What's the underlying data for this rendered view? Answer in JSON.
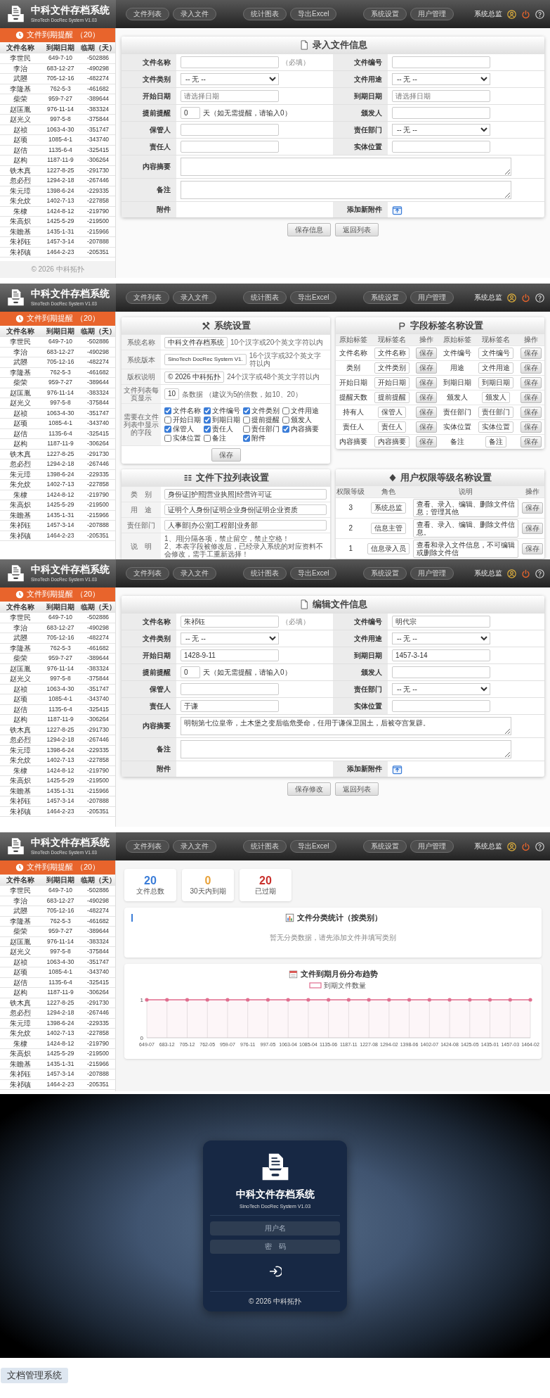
{
  "screens": [
    {
      "kind": "form",
      "header": {
        "title": "中科文件存档系统",
        "subtitle": "SinoTech DocRec System V1.03",
        "nav_groups": [
          [
            "文件列表",
            "录入文件"
          ],
          [
            "统计图表",
            "导出Excel"
          ],
          [
            "系统设置",
            "用户管理"
          ]
        ],
        "user": "系统总监"
      },
      "sidebar": {
        "title": "文件到期提醒",
        "count": "（20）",
        "columns": [
          "文件名称",
          "到期日期",
          "临期（天）"
        ],
        "footer": "© 2026 中科拓扑",
        "rows": [
          [
            "李世民",
            "649-7-10",
            "-502886"
          ],
          [
            "李治",
            "683-12-27",
            "-490298"
          ],
          [
            "武曌",
            "705-12-16",
            "-482274"
          ],
          [
            "李隆基",
            "762-5-3",
            "-461682"
          ],
          [
            "柴荣",
            "959-7-27",
            "-389644"
          ],
          [
            "赵匡胤",
            "976-11-14",
            "-383324"
          ],
          [
            "赵光义",
            "997-5-8",
            "-375844"
          ],
          [
            "赵祯",
            "1063-4-30",
            "-351747"
          ],
          [
            "赵顼",
            "1085-4-1",
            "-343740"
          ],
          [
            "赵佶",
            "1135-6-4",
            "-325415"
          ],
          [
            "赵构",
            "1187-11-9",
            "-306264"
          ],
          [
            "铁木真",
            "1227-8-25",
            "-291730"
          ],
          [
            "忽必烈",
            "1294-2-18",
            "-267446"
          ],
          [
            "朱元璋",
            "1398-6-24",
            "-229335"
          ],
          [
            "朱允炆",
            "1402-7-13",
            "-227858"
          ],
          [
            "朱棣",
            "1424-8-12",
            "-219790"
          ],
          [
            "朱高炽",
            "1425-5-29",
            "-219500"
          ],
          [
            "朱瞻基",
            "1435-1-31",
            "-215966"
          ],
          [
            "朱祁钰",
            "1457-3-14",
            "-207888"
          ],
          [
            "朱祁镇",
            "1464-2-23",
            "-205351"
          ]
        ]
      },
      "content": {
        "title": "录入文件信息",
        "rows": [
          {
            "kind": "pair",
            "cells": [
              {
                "label": "文件名称",
                "kind": "text",
                "hint": "（必填）"
              },
              {
                "label": "文件编号",
                "kind": "text"
              }
            ]
          },
          {
            "kind": "pair",
            "cells": [
              {
                "label": "文件类别",
                "kind": "select",
                "value": "-- 无 --"
              },
              {
                "label": "文件用途",
                "kind": "select",
                "value": "-- 无 --"
              }
            ]
          },
          {
            "kind": "pair",
            "cells": [
              {
                "label": "开始日期",
                "kind": "text",
                "placeholder": "请选择日期"
              },
              {
                "label": "到期日期",
                "kind": "text",
                "placeholder": "请选择日期"
              }
            ]
          },
          {
            "kind": "pair",
            "cells": [
              {
                "label": "提前提醒",
                "kind": "days",
                "value": "0",
                "unit": "天（如无需提醒，请输入0）"
              },
              {
                "label": "颁发人",
                "kind": "text"
              }
            ]
          },
          {
            "kind": "pair",
            "cells": [
              {
                "label": "保管人",
                "kind": "text"
              },
              {
                "label": "责任部门",
                "kind": "select",
                "value": "-- 无 --"
              }
            ]
          },
          {
            "kind": "pair",
            "cells": [
              {
                "label": "责任人",
                "kind": "text"
              },
              {
                "label": "实体位置",
                "kind": "text"
              }
            ]
          },
          {
            "kind": "wide",
            "cells": [
              {
                "label": "内容摘要",
                "kind": "textarea"
              }
            ]
          },
          {
            "kind": "wide",
            "cells": [
              {
                "label": "备注",
                "kind": "textarea"
              }
            ]
          },
          {
            "kind": "pair",
            "cells": [
              {
                "label": "附件",
                "kind": "empty"
              },
              {
                "label": "添加新附件",
                "kind": "attach"
              }
            ]
          }
        ],
        "buttons": [
          "保存信息",
          "返回列表"
        ]
      }
    },
    {
      "kind": "settings",
      "header": {
        "title": "中科文件存档系统",
        "subtitle": "SinoTech DocRec System V1.03",
        "nav_groups": [
          [
            "文件列表",
            "录入文件"
          ],
          [
            "统计图表",
            "导出Excel"
          ],
          [
            "系统设置",
            "用户管理"
          ]
        ],
        "user": "系统总监"
      },
      "sidebar": {
        "title": "文件到期提醒",
        "count": "（20）",
        "columns": [
          "文件名称",
          "到期日期",
          "临期（天）"
        ],
        "rows": [
          [
            "李世民",
            "649-7-10",
            "-502886"
          ],
          [
            "李治",
            "683-12-27",
            "-490298"
          ],
          [
            "武曌",
            "705-12-16",
            "-482274"
          ],
          [
            "李隆基",
            "762-5-3",
            "-461682"
          ],
          [
            "柴荣",
            "959-7-27",
            "-389644"
          ],
          [
            "赵匡胤",
            "976-11-14",
            "-383324"
          ],
          [
            "赵光义",
            "997-5-8",
            "-375844"
          ],
          [
            "赵祯",
            "1063-4-30",
            "-351747"
          ],
          [
            "赵顼",
            "1085-4-1",
            "-343740"
          ],
          [
            "赵佶",
            "1135-6-4",
            "-325415"
          ],
          [
            "赵构",
            "1187-11-9",
            "-306264"
          ],
          [
            "铁木真",
            "1227-8-25",
            "-291730"
          ],
          [
            "忽必烈",
            "1294-2-18",
            "-267446"
          ],
          [
            "朱元璋",
            "1398-6-24",
            "-229335"
          ],
          [
            "朱允炆",
            "1402-7-13",
            "-227858"
          ],
          [
            "朱棣",
            "1424-8-12",
            "-219790"
          ],
          [
            "朱高炽",
            "1425-5-29",
            "-219500"
          ],
          [
            "朱瞻基",
            "1435-1-31",
            "-215966"
          ],
          [
            "朱祁钰",
            "1457-3-14",
            "-207888"
          ],
          [
            "朱祁镇",
            "1464-2-23",
            "-205351"
          ]
        ]
      },
      "content": {
        "system": {
          "title": "系统设置",
          "button": "保存",
          "rows": [
            {
              "kind": "text",
              "label": "系统名称",
              "value": "中科文件存档系统",
              "note": "10个汉字或20个英文字符以内"
            },
            {
              "kind": "latin",
              "label": "系统版本",
              "value": "SinoTech DocRec System V1.",
              "note": "16个汉字或32个英文字符以内"
            },
            {
              "kind": "text",
              "label": "版权说明",
              "value": "© 2026 中科拓扑",
              "note": "24个汉字或48个英文字符以内"
            },
            {
              "kind": "text",
              "label": "文件列表每页显示",
              "value": "10",
              "note": "条数据 （建议为5的倍数，如10、20）"
            },
            {
              "kind": "checks",
              "label": "需要在文件列表中显示的字段",
              "options": [
                {
                  "label": "文件名称",
                  "checked": true
                },
                {
                  "label": "文件编号",
                  "checked": true
                },
                {
                  "label": "文件类别",
                  "checked": true
                },
                {
                  "label": "文件用途",
                  "checked": false
                },
                {
                  "label": "开始日期",
                  "checked": false
                },
                {
                  "label": "到期日期",
                  "checked": true
                },
                {
                  "label": "提前提醒",
                  "checked": false
                },
                {
                  "label": "颁发人",
                  "checked": false
                },
                {
                  "label": "保管人",
                  "checked": true
                },
                {
                  "label": "责任人",
                  "checked": true
                },
                {
                  "label": "责任部门",
                  "checked": false
                },
                {
                  "label": "内容摘要",
                  "checked": true
                },
                {
                  "label": "实体位置",
                  "checked": false
                },
                {
                  "label": "备注",
                  "checked": false
                },
                {
                  "label": "附件",
                  "checked": true
                }
              ]
            }
          ]
        },
        "labels": {
          "title": "字段标签名称设置",
          "columns": [
            "原始标签",
            "现标签名",
            "操作",
            "原始标签",
            "现标签名",
            "操作"
          ],
          "rows": [
            [
              {
                "original": "文件名称",
                "current": "文件名称",
                "action": "保存"
              },
              {
                "original": "文件编号",
                "current": "文件编号",
                "action": "保存"
              }
            ],
            [
              {
                "original": "类别",
                "current": "文件类别",
                "action": "保存"
              },
              {
                "original": "用途",
                "current": "文件用途",
                "action": "保存"
              }
            ],
            [
              {
                "original": "开始日期",
                "current": "开始日期",
                "action": "保存"
              },
              {
                "original": "到期日期",
                "current": "到期日期",
                "action": "保存"
              }
            ],
            [
              {
                "original": "提醒天数",
                "current": "提前提醒",
                "action": "保存"
              },
              {
                "original": "颁发人",
                "current": "颁发人",
                "action": "保存"
              }
            ],
            [
              {
                "original": "持有人",
                "current": "保管人",
                "action": "保存"
              },
              {
                "original": "责任部门",
                "current": "责任部门",
                "action": "保存"
              }
            ],
            [
              {
                "original": "责任人",
                "current": "责任人",
                "action": "保存"
              },
              {
                "original": "实体位置",
                "current": "实体位置",
                "action": "保存"
              }
            ],
            [
              {
                "original": "内容摘要",
                "current": "内容摘要",
                "action": "保存"
              },
              {
                "original": "备注",
                "current": "备注",
                "action": "保存"
              }
            ]
          ]
        },
        "dropdowns": {
          "title": "文件下拉列表设置",
          "rows": [
            {
              "label": "类　别",
              "value": "身份证|护照|营业执照|经营许可证"
            },
            {
              "label": "用　途",
              "value": "证明个人身份|证明企业身份|证明企业资质"
            },
            {
              "label": "责任部门",
              "value": "人事部|办公室|工程部|业务部"
            }
          ],
          "note_label": "说　明",
          "notes": [
            "1、用|分隔各项，禁止留空，禁止空格！",
            "2、本表字段被修改后，已经录入系统的对应资料不会修改，需手工重新选择！"
          ]
        },
        "levels": {
          "title": "用户权限等级名称设置",
          "columns": [
            "权限等级",
            "角色",
            "说明",
            "操作"
          ],
          "rows": [
            {
              "grade": "3",
              "role": "系统总监",
              "desc": "查看、录入、编辑、删除文件信息；管理其他",
              "action": "保存"
            },
            {
              "grade": "2",
              "role": "信息主管",
              "desc": "查看、录入、编辑、删除文件信息。",
              "action": "保存"
            },
            {
              "grade": "1",
              "role": "信息录入员",
              "desc": "查看和录入文件信息，不可编辑或删除文件信",
              "action": "保存"
            }
          ]
        }
      }
    },
    {
      "kind": "form",
      "header": {
        "title": "中科文件存档系统",
        "subtitle": "SinoTech DocRec System V1.03",
        "nav_groups": [
          [
            "文件列表",
            "录入文件"
          ],
          [
            "统计图表",
            "导出Excel"
          ],
          [
            "系统设置",
            "用户管理"
          ]
        ],
        "user": "系统总监"
      },
      "sidebar": {
        "title": "文件到期提醒",
        "count": "（20）",
        "columns": [
          "文件名称",
          "到期日期",
          "临期（天）"
        ],
        "rows": [
          [
            "李世民",
            "649-7-10",
            "-502886"
          ],
          [
            "李治",
            "683-12-27",
            "-490298"
          ],
          [
            "武曌",
            "705-12-16",
            "-482274"
          ],
          [
            "李隆基",
            "762-5-3",
            "-461682"
          ],
          [
            "柴荣",
            "959-7-27",
            "-389644"
          ],
          [
            "赵匡胤",
            "976-11-14",
            "-383324"
          ],
          [
            "赵光义",
            "997-5-8",
            "-375844"
          ],
          [
            "赵祯",
            "1063-4-30",
            "-351747"
          ],
          [
            "赵顼",
            "1085-4-1",
            "-343740"
          ],
          [
            "赵佶",
            "1135-6-4",
            "-325415"
          ],
          [
            "赵构",
            "1187-11-9",
            "-306264"
          ],
          [
            "铁木真",
            "1227-8-25",
            "-291730"
          ],
          [
            "忽必烈",
            "1294-2-18",
            "-267446"
          ],
          [
            "朱元璋",
            "1398-6-24",
            "-229335"
          ],
          [
            "朱允炆",
            "1402-7-13",
            "-227858"
          ],
          [
            "朱棣",
            "1424-8-12",
            "-219790"
          ],
          [
            "朱高炽",
            "1425-5-29",
            "-219500"
          ],
          [
            "朱瞻基",
            "1435-1-31",
            "-215966"
          ],
          [
            "朱祁钰",
            "1457-3-14",
            "-207888"
          ],
          [
            "朱祁镇",
            "1464-2-23",
            "-205351"
          ]
        ]
      },
      "content": {
        "title": "编辑文件信息",
        "rows": [
          {
            "kind": "pair",
            "cells": [
              {
                "label": "文件名称",
                "kind": "text",
                "value": "朱祁钰",
                "hint": "（必填）"
              },
              {
                "label": "文件编号",
                "kind": "text",
                "value": "明代宗"
              }
            ]
          },
          {
            "kind": "pair",
            "cells": [
              {
                "label": "文件类别",
                "kind": "select",
                "value": "-- 无 --"
              },
              {
                "label": "文件用途",
                "kind": "select",
                "value": "-- 无 --"
              }
            ]
          },
          {
            "kind": "pair",
            "cells": [
              {
                "label": "开始日期",
                "kind": "text",
                "value": "1428-9-11"
              },
              {
                "label": "到期日期",
                "kind": "text",
                "value": "1457-3-14"
              }
            ]
          },
          {
            "kind": "pair",
            "cells": [
              {
                "label": "提前提醒",
                "kind": "days",
                "value": "0",
                "unit": "天（如无需提醒，请输入0）"
              },
              {
                "label": "颁发人",
                "kind": "text"
              }
            ]
          },
          {
            "kind": "pair",
            "cells": [
              {
                "label": "保管人",
                "kind": "text"
              },
              {
                "label": "责任部门",
                "kind": "select",
                "value": "-- 无 --"
              }
            ]
          },
          {
            "kind": "pair",
            "cells": [
              {
                "label": "责任人",
                "kind": "text",
                "value": "于谦"
              },
              {
                "label": "实体位置",
                "kind": "text"
              }
            ]
          },
          {
            "kind": "wide",
            "cells": [
              {
                "label": "内容摘要",
                "kind": "textarea",
                "value": "明朝第七位皇帝，土木堡之变后临危受命，任用于谦保卫国土，后被夺宫复辟。"
              }
            ]
          },
          {
            "kind": "wide",
            "cells": [
              {
                "label": "备注",
                "kind": "textarea"
              }
            ]
          },
          {
            "kind": "pair",
            "cells": [
              {
                "label": "附件",
                "kind": "empty"
              },
              {
                "label": "添加新附件",
                "kind": "attach"
              }
            ]
          }
        ],
        "buttons": [
          "保存修改",
          "返回列表"
        ]
      }
    },
    {
      "kind": "stats",
      "header": {
        "title": "中科文件存档系统",
        "subtitle": "SinoTech DocRec System V1.03",
        "nav_groups": [
          [
            "文件列表",
            "录入文件"
          ],
          [
            "统计图表",
            "导出Excel"
          ],
          [
            "系统设置",
            "用户管理"
          ]
        ],
        "user": "系统总监"
      },
      "sidebar": {
        "title": "文件到期提醒",
        "count": "（20）",
        "columns": [
          "文件名称",
          "到期日期",
          "临期（天）"
        ],
        "rows": [
          [
            "李世民",
            "649-7-10",
            "-502886"
          ],
          [
            "李治",
            "683-12-27",
            "-490298"
          ],
          [
            "武曌",
            "705-12-16",
            "-482274"
          ],
          [
            "李隆基",
            "762-5-3",
            "-461682"
          ],
          [
            "柴荣",
            "959-7-27",
            "-389644"
          ],
          [
            "赵匡胤",
            "976-11-14",
            "-383324"
          ],
          [
            "赵光义",
            "997-5-8",
            "-375844"
          ],
          [
            "赵祯",
            "1063-4-30",
            "-351747"
          ],
          [
            "赵顼",
            "1085-4-1",
            "-343740"
          ],
          [
            "赵佶",
            "1135-6-4",
            "-325415"
          ],
          [
            "赵构",
            "1187-11-9",
            "-306264"
          ],
          [
            "铁木真",
            "1227-8-25",
            "-291730"
          ],
          [
            "忽必烈",
            "1294-2-18",
            "-267446"
          ],
          [
            "朱元璋",
            "1398-6-24",
            "-229335"
          ],
          [
            "朱允炆",
            "1402-7-13",
            "-227858"
          ],
          [
            "朱棣",
            "1424-8-12",
            "-219790"
          ],
          [
            "朱高炽",
            "1425-5-29",
            "-219500"
          ],
          [
            "朱瞻基",
            "1435-1-31",
            "-215966"
          ],
          [
            "朱祁钰",
            "1457-3-14",
            "-207888"
          ],
          [
            "朱祁镇",
            "1464-2-23",
            "-205351"
          ]
        ]
      },
      "content": {
        "cards": [
          {
            "value": "20",
            "label": "文件总数",
            "color": "#3b7dd8"
          },
          {
            "value": "0",
            "label": "30天内到期",
            "color": "#e8a23a"
          },
          {
            "value": "20",
            "label": "已过期",
            "color": "#c9302c"
          }
        ],
        "category": {
          "title": "文件分类统计（按类别）",
          "empty": "暂无分类数据，请先添加文件并填写类别"
        },
        "trend": {
          "title": "文件到期月份分布趋势",
          "chart_data": {
            "type": "line",
            "categories": [
              "649-07",
              "683-12",
              "705-12",
              "762-05",
              "959-07",
              "976-11",
              "997-05",
              "1063-04",
              "1085-04",
              "1135-06",
              "1187-11",
              "1227-08",
              "1294-02",
              "1398-06",
              "1402-07",
              "1424-08",
              "1425-05",
              "1435-01",
              "1457-03",
              "1464-02"
            ],
            "ylim": [
              0,
              1
            ],
            "yticks": [
              0,
              1
            ],
            "grid": true,
            "series": [
              {
                "name": "到期文件数量",
                "color": "#e06d8e",
                "values": [
                  1,
                  1,
                  1,
                  1,
                  1,
                  1,
                  1,
                  1,
                  1,
                  1,
                  1,
                  1,
                  1,
                  1,
                  1,
                  1,
                  1,
                  1,
                  1,
                  1
                ]
              }
            ]
          }
        }
      }
    }
  ],
  "login": {
    "title": "中科文件存档系统",
    "subtitle": "SinoTech DocRec System V1.03",
    "username_placeholder": "用户名",
    "password_placeholder": "密　码",
    "footer": "© 2026 中科拓扑"
  },
  "tag": "文档管理系统"
}
